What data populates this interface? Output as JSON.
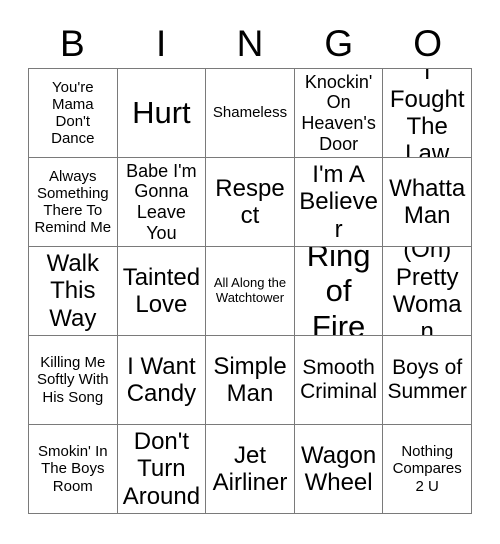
{
  "card": {
    "type": "bingo-card",
    "headers": [
      "B",
      "I",
      "N",
      "G",
      "O"
    ],
    "grid_size": 5,
    "colors": {
      "background": "#ffffff",
      "text": "#000000",
      "border": "#7a7a7a"
    },
    "rows": [
      [
        {
          "text": "You're Mama Don't Dance",
          "size": "sm"
        },
        {
          "text": "Hurt",
          "size": "xxl"
        },
        {
          "text": "Shameless",
          "size": "sm"
        },
        {
          "text": "Knockin' On Heaven's Door",
          "size": "md"
        },
        {
          "text": "I Fought The Law",
          "size": "xl"
        }
      ],
      [
        {
          "text": "Always Something There To Remind Me",
          "size": "sm"
        },
        {
          "text": "Babe I'm Gonna Leave You",
          "size": "md"
        },
        {
          "text": "Respect",
          "size": "xl"
        },
        {
          "text": "I'm A Believer",
          "size": "xl"
        },
        {
          "text": "Whatta Man",
          "size": "xl"
        }
      ],
      [
        {
          "text": "Walk This Way",
          "size": "xl"
        },
        {
          "text": "Tainted Love",
          "size": "xl"
        },
        {
          "text": "All Along the Watchtower",
          "size": "xs"
        },
        {
          "text": "Ring of Fire",
          "size": "xxl"
        },
        {
          "text": "(Oh) Pretty Woman",
          "size": "xl"
        }
      ],
      [
        {
          "text": "Killing Me Softly With His Song",
          "size": "sm"
        },
        {
          "text": "I Want Candy",
          "size": "xl"
        },
        {
          "text": "Simple Man",
          "size": "xl"
        },
        {
          "text": "Smooth Criminal",
          "size": "lg"
        },
        {
          "text": "Boys of Summer",
          "size": "lg"
        }
      ],
      [
        {
          "text": "Smokin' In The Boys Room",
          "size": "sm"
        },
        {
          "text": "Don't Turn Around",
          "size": "xl"
        },
        {
          "text": "Jet Airliner",
          "size": "xl"
        },
        {
          "text": "Wagon Wheel",
          "size": "xl"
        },
        {
          "text": "Nothing Compares 2 U",
          "size": "sm"
        }
      ]
    ]
  }
}
